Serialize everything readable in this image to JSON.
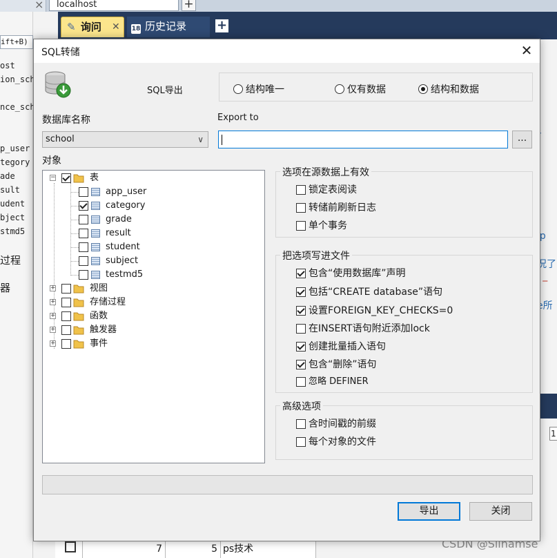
{
  "browser": {
    "url": "localhost",
    "new_tab_symbol": "+"
  },
  "app_tabs": {
    "query_tab_label": "询问",
    "history_tab_label": "历史记录",
    "history_icon_text": "18",
    "add_tab_symbol": "+"
  },
  "background": {
    "shortcut_text": "ift+B)",
    "tree_items": [
      "ost",
      "ion_sch",
      "nce_sch",
      "p_user",
      "tegory",
      "ade",
      "sult",
      "udent",
      "bject",
      "stmd5",
      "过程",
      "器"
    ],
    "code_fragments": [
      "r",
      "ip",
      "况了",
      "' _",
      "e所"
    ],
    "grid_row": {
      "num": "7",
      "val": "5",
      "text": "ps技术"
    },
    "right_box_value": "1",
    "watermark": "CSDN @Slinamse"
  },
  "dialog": {
    "title": "SQL转储",
    "close_symbol": "✕",
    "mode_label": "SQL导出",
    "modes": [
      {
        "label": "结构唯一",
        "selected": false
      },
      {
        "label": "仅有数据",
        "selected": false
      },
      {
        "label": "结构和数据",
        "selected": true
      }
    ],
    "database_label": "数据库名称",
    "database_value": "school",
    "export_to_label": "Export to",
    "export_to_value": "",
    "browse_label": "...",
    "objects_label": "对象",
    "tree": {
      "tables_label": "表",
      "tables": [
        {
          "name": "app_user",
          "checked": false
        },
        {
          "name": "category",
          "checked": true
        },
        {
          "name": "grade",
          "checked": false
        },
        {
          "name": "result",
          "checked": false
        },
        {
          "name": "student",
          "checked": false
        },
        {
          "name": "subject",
          "checked": false
        },
        {
          "name": "testmd5",
          "checked": false
        }
      ],
      "groups": [
        "视图",
        "存储过程",
        "函数",
        "触发器",
        "事件"
      ]
    },
    "source_options": {
      "title": "选项在源数据上有效",
      "items": [
        {
          "label": "锁定表阅读",
          "checked": false
        },
        {
          "label": "转储前刷新日志",
          "checked": false
        },
        {
          "label": "单个事务",
          "checked": false
        }
      ]
    },
    "file_options": {
      "title": "把选项写进文件",
      "items": [
        {
          "label": "包含“使用数据库”声明",
          "checked": true
        },
        {
          "label": "包括“CREATE database”语句",
          "checked": true
        },
        {
          "label": "设置FOREIGN_KEY_CHECKS=0",
          "checked": true
        },
        {
          "label": "在INSERT语句附近添加lock",
          "checked": false
        },
        {
          "label": "创建批量插入语句",
          "checked": true
        },
        {
          "label": "包含“删除”语句",
          "checked": true
        },
        {
          "label": "忽略 DEFINER",
          "checked": false
        }
      ]
    },
    "advanced_options": {
      "title": "高级选项",
      "items": [
        {
          "label": "含时间戳的前缀",
          "checked": false
        },
        {
          "label": "每个对象的文件",
          "checked": false
        }
      ]
    },
    "export_button": "导出",
    "close_button": "关闭"
  }
}
